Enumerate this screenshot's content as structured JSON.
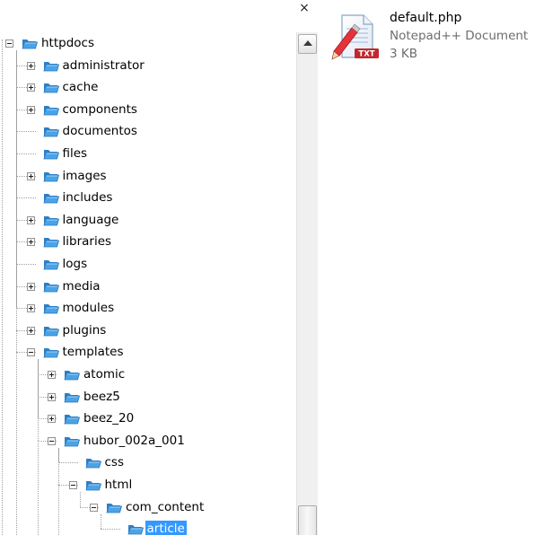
{
  "tree": {
    "close_glyph": "×",
    "items": [
      {
        "label": "httpdocs",
        "level": 0,
        "expander": "minus"
      },
      {
        "label": "administrator",
        "level": 1,
        "expander": "plus"
      },
      {
        "label": "cache",
        "level": 1,
        "expander": "plus"
      },
      {
        "label": "components",
        "level": 1,
        "expander": "plus"
      },
      {
        "label": "documentos",
        "level": 1,
        "expander": "none"
      },
      {
        "label": "files",
        "level": 1,
        "expander": "none"
      },
      {
        "label": "images",
        "level": 1,
        "expander": "plus"
      },
      {
        "label": "includes",
        "level": 1,
        "expander": "none"
      },
      {
        "label": "language",
        "level": 1,
        "expander": "plus"
      },
      {
        "label": "libraries",
        "level": 1,
        "expander": "plus"
      },
      {
        "label": "logs",
        "level": 1,
        "expander": "none"
      },
      {
        "label": "media",
        "level": 1,
        "expander": "plus"
      },
      {
        "label": "modules",
        "level": 1,
        "expander": "plus"
      },
      {
        "label": "plugins",
        "level": 1,
        "expander": "plus"
      },
      {
        "label": "templates",
        "level": 1,
        "expander": "minus"
      },
      {
        "label": "atomic",
        "level": 2,
        "expander": "plus"
      },
      {
        "label": "beez5",
        "level": 2,
        "expander": "plus"
      },
      {
        "label": "beez_20",
        "level": 2,
        "expander": "plus"
      },
      {
        "label": "hubor_002a_001",
        "level": 2,
        "expander": "minus"
      },
      {
        "label": "css",
        "level": 3,
        "expander": "none"
      },
      {
        "label": "html",
        "level": 3,
        "expander": "minus"
      },
      {
        "label": "com_content",
        "level": 4,
        "expander": "minus"
      },
      {
        "label": "article",
        "level": 5,
        "expander": "none",
        "selected": true
      }
    ]
  },
  "file": {
    "name": "default.php",
    "type": "Notepad++ Document",
    "size": "3 KB",
    "icon": "notepad-plus-plus-file-icon",
    "icon_badge": "TXT"
  },
  "colors": {
    "selection": "#3399ff",
    "folder": "#4aa3e6",
    "secondary_text": "#6d6d6d"
  }
}
